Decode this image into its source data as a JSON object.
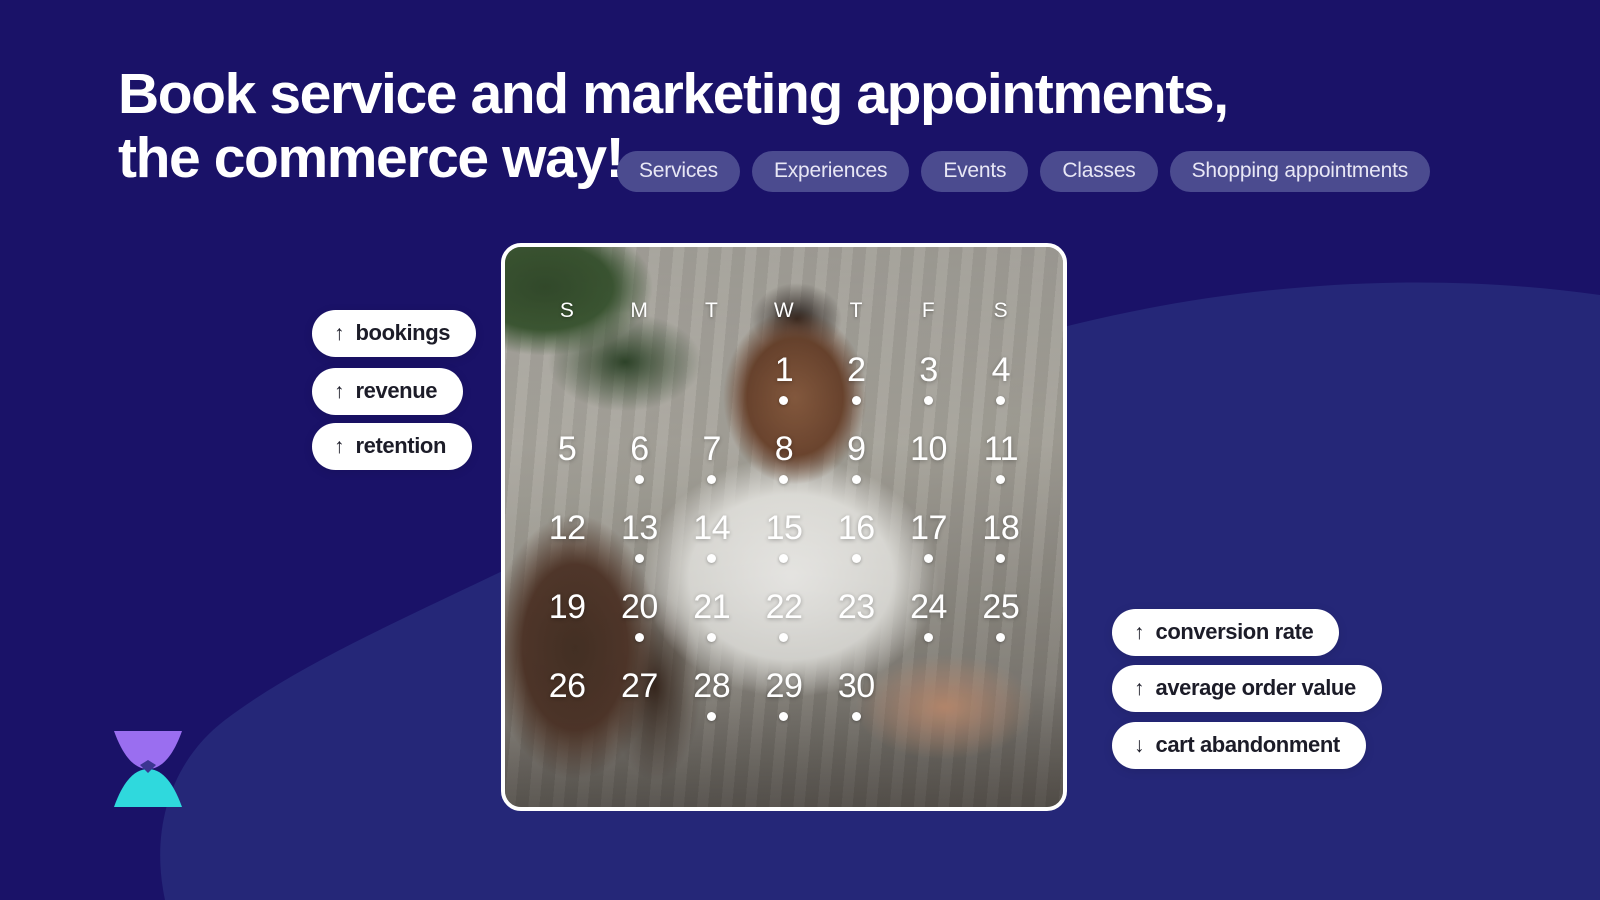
{
  "theme": {
    "background": "#1a1268",
    "swoosh": "#252778",
    "pill_bg": "#4b4b8f",
    "badge_bg": "#ffffff",
    "badge_text": "#1c1c28",
    "heading_text": "#ffffff",
    "logo_top": "#9a6ef0",
    "logo_bottom": "#2fd9dd"
  },
  "hero": {
    "headline_line1": "Book service and marketing appointments,",
    "headline_line2": "the commerce way!"
  },
  "categories": [
    {
      "label": "Services"
    },
    {
      "label": "Experiences"
    },
    {
      "label": "Events"
    },
    {
      "label": "Classes"
    },
    {
      "label": "Shopping appointments"
    }
  ],
  "metrics_left": [
    {
      "arrow": "↑",
      "direction": "up",
      "label": "bookings"
    },
    {
      "arrow": "↑",
      "direction": "up",
      "label": "revenue"
    },
    {
      "arrow": "↑",
      "direction": "up",
      "label": "retention"
    }
  ],
  "metrics_right": [
    {
      "arrow": "↑",
      "direction": "up",
      "label": "conversion rate"
    },
    {
      "arrow": "↑",
      "direction": "up",
      "label": "average order value"
    },
    {
      "arrow": "↓",
      "direction": "down",
      "label": "cart abandonment"
    }
  ],
  "calendar": {
    "weekday_headers": [
      "S",
      "M",
      "T",
      "W",
      "T",
      "F",
      "S"
    ],
    "leading_blanks": 3,
    "days": [
      {
        "day": "1",
        "weekday": "W",
        "has_event": true
      },
      {
        "day": "2",
        "weekday": "T",
        "has_event": true
      },
      {
        "day": "3",
        "weekday": "F",
        "has_event": true
      },
      {
        "day": "4",
        "weekday": "S",
        "has_event": true
      },
      {
        "day": "5",
        "weekday": "S",
        "has_event": false
      },
      {
        "day": "6",
        "weekday": "M",
        "has_event": true
      },
      {
        "day": "7",
        "weekday": "T",
        "has_event": true
      },
      {
        "day": "8",
        "weekday": "W",
        "has_event": true
      },
      {
        "day": "9",
        "weekday": "T",
        "has_event": true
      },
      {
        "day": "10",
        "weekday": "F",
        "has_event": false
      },
      {
        "day": "11",
        "weekday": "S",
        "has_event": true
      },
      {
        "day": "12",
        "weekday": "S",
        "has_event": false
      },
      {
        "day": "13",
        "weekday": "M",
        "has_event": true
      },
      {
        "day": "14",
        "weekday": "T",
        "has_event": true
      },
      {
        "day": "15",
        "weekday": "W",
        "has_event": true
      },
      {
        "day": "16",
        "weekday": "T",
        "has_event": true
      },
      {
        "day": "17",
        "weekday": "F",
        "has_event": true
      },
      {
        "day": "18",
        "weekday": "S",
        "has_event": true
      },
      {
        "day": "19",
        "weekday": "S",
        "has_event": false
      },
      {
        "day": "20",
        "weekday": "M",
        "has_event": true
      },
      {
        "day": "21",
        "weekday": "T",
        "has_event": true
      },
      {
        "day": "22",
        "weekday": "W",
        "has_event": true
      },
      {
        "day": "23",
        "weekday": "T",
        "has_event": false
      },
      {
        "day": "24",
        "weekday": "F",
        "has_event": true
      },
      {
        "day": "25",
        "weekday": "S",
        "has_event": true
      },
      {
        "day": "26",
        "weekday": "S",
        "has_event": false
      },
      {
        "day": "27",
        "weekday": "M",
        "has_event": false
      },
      {
        "day": "28",
        "weekday": "T",
        "has_event": true
      },
      {
        "day": "29",
        "weekday": "W",
        "has_event": true
      },
      {
        "day": "30",
        "weekday": "T",
        "has_event": true
      }
    ]
  },
  "logo": {
    "name": "hourglass-logo"
  }
}
